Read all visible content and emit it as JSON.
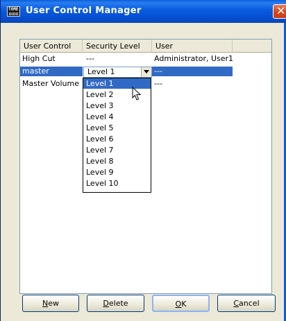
{
  "window": {
    "title": "User Control Manager",
    "app_icon": "yamaha-app-icon",
    "app_icon_text": "TOME",
    "close_glyph": "✕"
  },
  "table": {
    "columns": [
      "User Control",
      "Security Level",
      "User"
    ],
    "rows": [
      {
        "user_control": "High Cut",
        "security_level": "---",
        "user": "Administrator, User1"
      },
      {
        "user_control": "master",
        "security_level": "Level 1",
        "user": "---",
        "selected": true
      },
      {
        "user_control": "Master Volume",
        "security_level": "",
        "user": "---"
      }
    ]
  },
  "combo": {
    "value": "Level 1",
    "options": [
      "Level 1",
      "Level 2",
      "Level 3",
      "Level 4",
      "Level 5",
      "Level 6",
      "Level 7",
      "Level 8",
      "Level 9",
      "Level 10"
    ],
    "highlighted": "Level 1"
  },
  "buttons": {
    "new": {
      "label": "New",
      "mnemonic": "N"
    },
    "delete": {
      "label": "Delete",
      "mnemonic": "D"
    },
    "ok": {
      "label": "OK",
      "mnemonic": "O"
    },
    "cancel": {
      "label": "Cancel",
      "mnemonic": "C"
    }
  },
  "colors": {
    "titlebar": "#0b5ee0",
    "selection": "#316ac5",
    "face": "#ece9d8"
  }
}
